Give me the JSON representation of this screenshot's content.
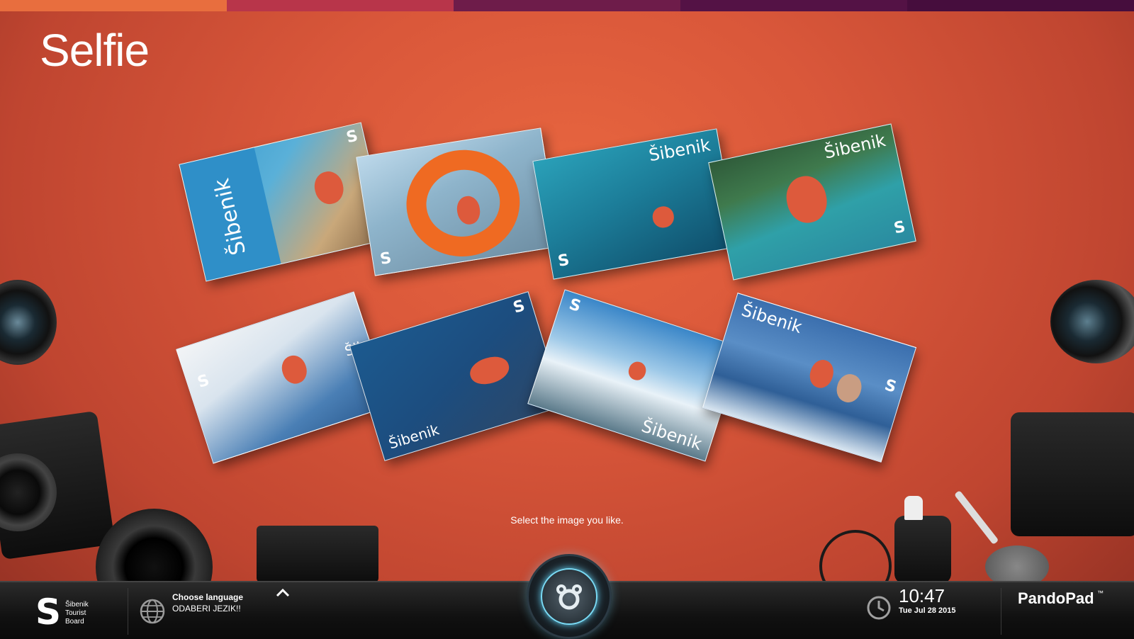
{
  "top_stripes": [
    "#e86e3e",
    "#b8354a",
    "#7a1f4a",
    "#5c1444",
    "#4a0e3e"
  ],
  "page_title": "Selfie",
  "cards": [
    {
      "name": "card-snorkel-girl",
      "brand": "Šibenik",
      "logo": "S"
    },
    {
      "name": "card-lifebuoy-girl",
      "brand": "",
      "logo": "S"
    },
    {
      "name": "card-underwater-swimmer",
      "brand": "Šibenik",
      "logo": "S"
    },
    {
      "name": "card-man-in-water",
      "brand": "Šibenik",
      "logo": "S"
    },
    {
      "name": "card-couple-terrace",
      "brand": "Šib",
      "logo": "S"
    },
    {
      "name": "card-diver-selfie",
      "brand": "Šibenik",
      "logo": "S"
    },
    {
      "name": "card-skydiver",
      "brand": "Šibenik",
      "logo": "S"
    },
    {
      "name": "card-couple-boat",
      "brand": "Šibenik",
      "logo": "S"
    }
  ],
  "hint": "Select the image you like.",
  "taskbar": {
    "board_line1": "Šibenik",
    "board_line2": "Tourist",
    "board_line3": "Board",
    "language_title": "Choose language",
    "language_subtitle": "ODABERI JEZIK!!",
    "time": "10:47",
    "date": "Tue Jul 28 2015",
    "brand": "PandoPad",
    "brand_tm": "™"
  },
  "icons": {
    "globe": "globe-icon",
    "chevron": "chevron-up-icon",
    "clock": "clock-icon",
    "home": "home-button-icon"
  }
}
